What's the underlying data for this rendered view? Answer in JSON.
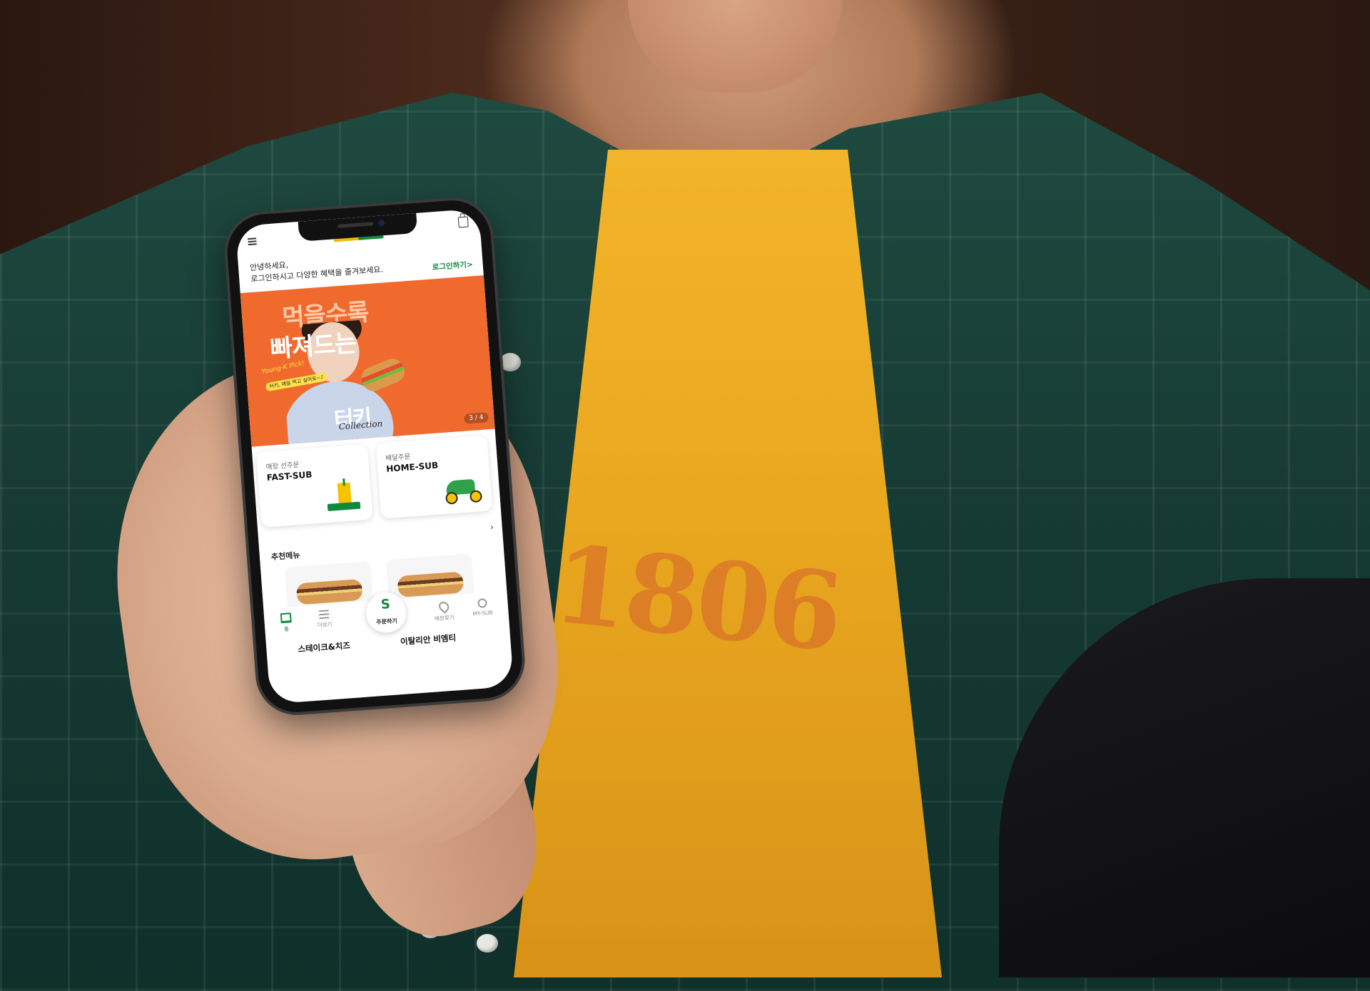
{
  "colors": {
    "brand_green": "#0f8a3c",
    "brand_yellow": "#f5c400",
    "banner_orange": "#f06a2e"
  },
  "shirt_print": "1806",
  "app": {
    "greeting_line1": "안녕하세요,",
    "greeting_line2": "로그인하시고 다양한 혜택을 즐겨보세요.",
    "login_link": "로그인하기>",
    "banner": {
      "headline_1": "먹을수록",
      "headline_2": "빠져드는",
      "tag": "Young-K Pick!",
      "tag_small": "터키, 매일 먹고 싶어요~♪",
      "brand": "터키",
      "brand_sub": "Collection",
      "pager": "3 / 4"
    },
    "cards": [
      {
        "sub": "매장 선주문",
        "main": "FAST-SUB",
        "icon": "cup-icon"
      },
      {
        "sub": "배달주문",
        "main": "HOME-SUB",
        "icon": "scooter-icon"
      }
    ],
    "recommended_title": "추천메뉴",
    "recommended_more": "›",
    "recommended": [
      {
        "name": "스테이크&치즈"
      },
      {
        "name": "이탈리안 비엠티"
      }
    ],
    "tabbar": {
      "home": "홈",
      "more": "더보기",
      "order": "주문하기",
      "order_glyph": "S",
      "store": "매장찾기",
      "my": "MY-SUB"
    }
  }
}
